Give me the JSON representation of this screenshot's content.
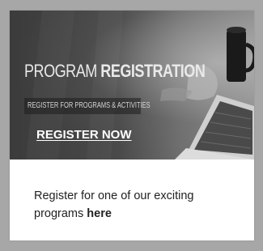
{
  "banner": {
    "title_light": "PROGRAM ",
    "title_bold": "REGISTRATION",
    "subtitle": "REGISTER FOR PROGRAMS & ACTIVITIES",
    "cta": "REGISTER NOW"
  },
  "content": {
    "text": "Register for one of our exciting programs ",
    "link": "here"
  }
}
